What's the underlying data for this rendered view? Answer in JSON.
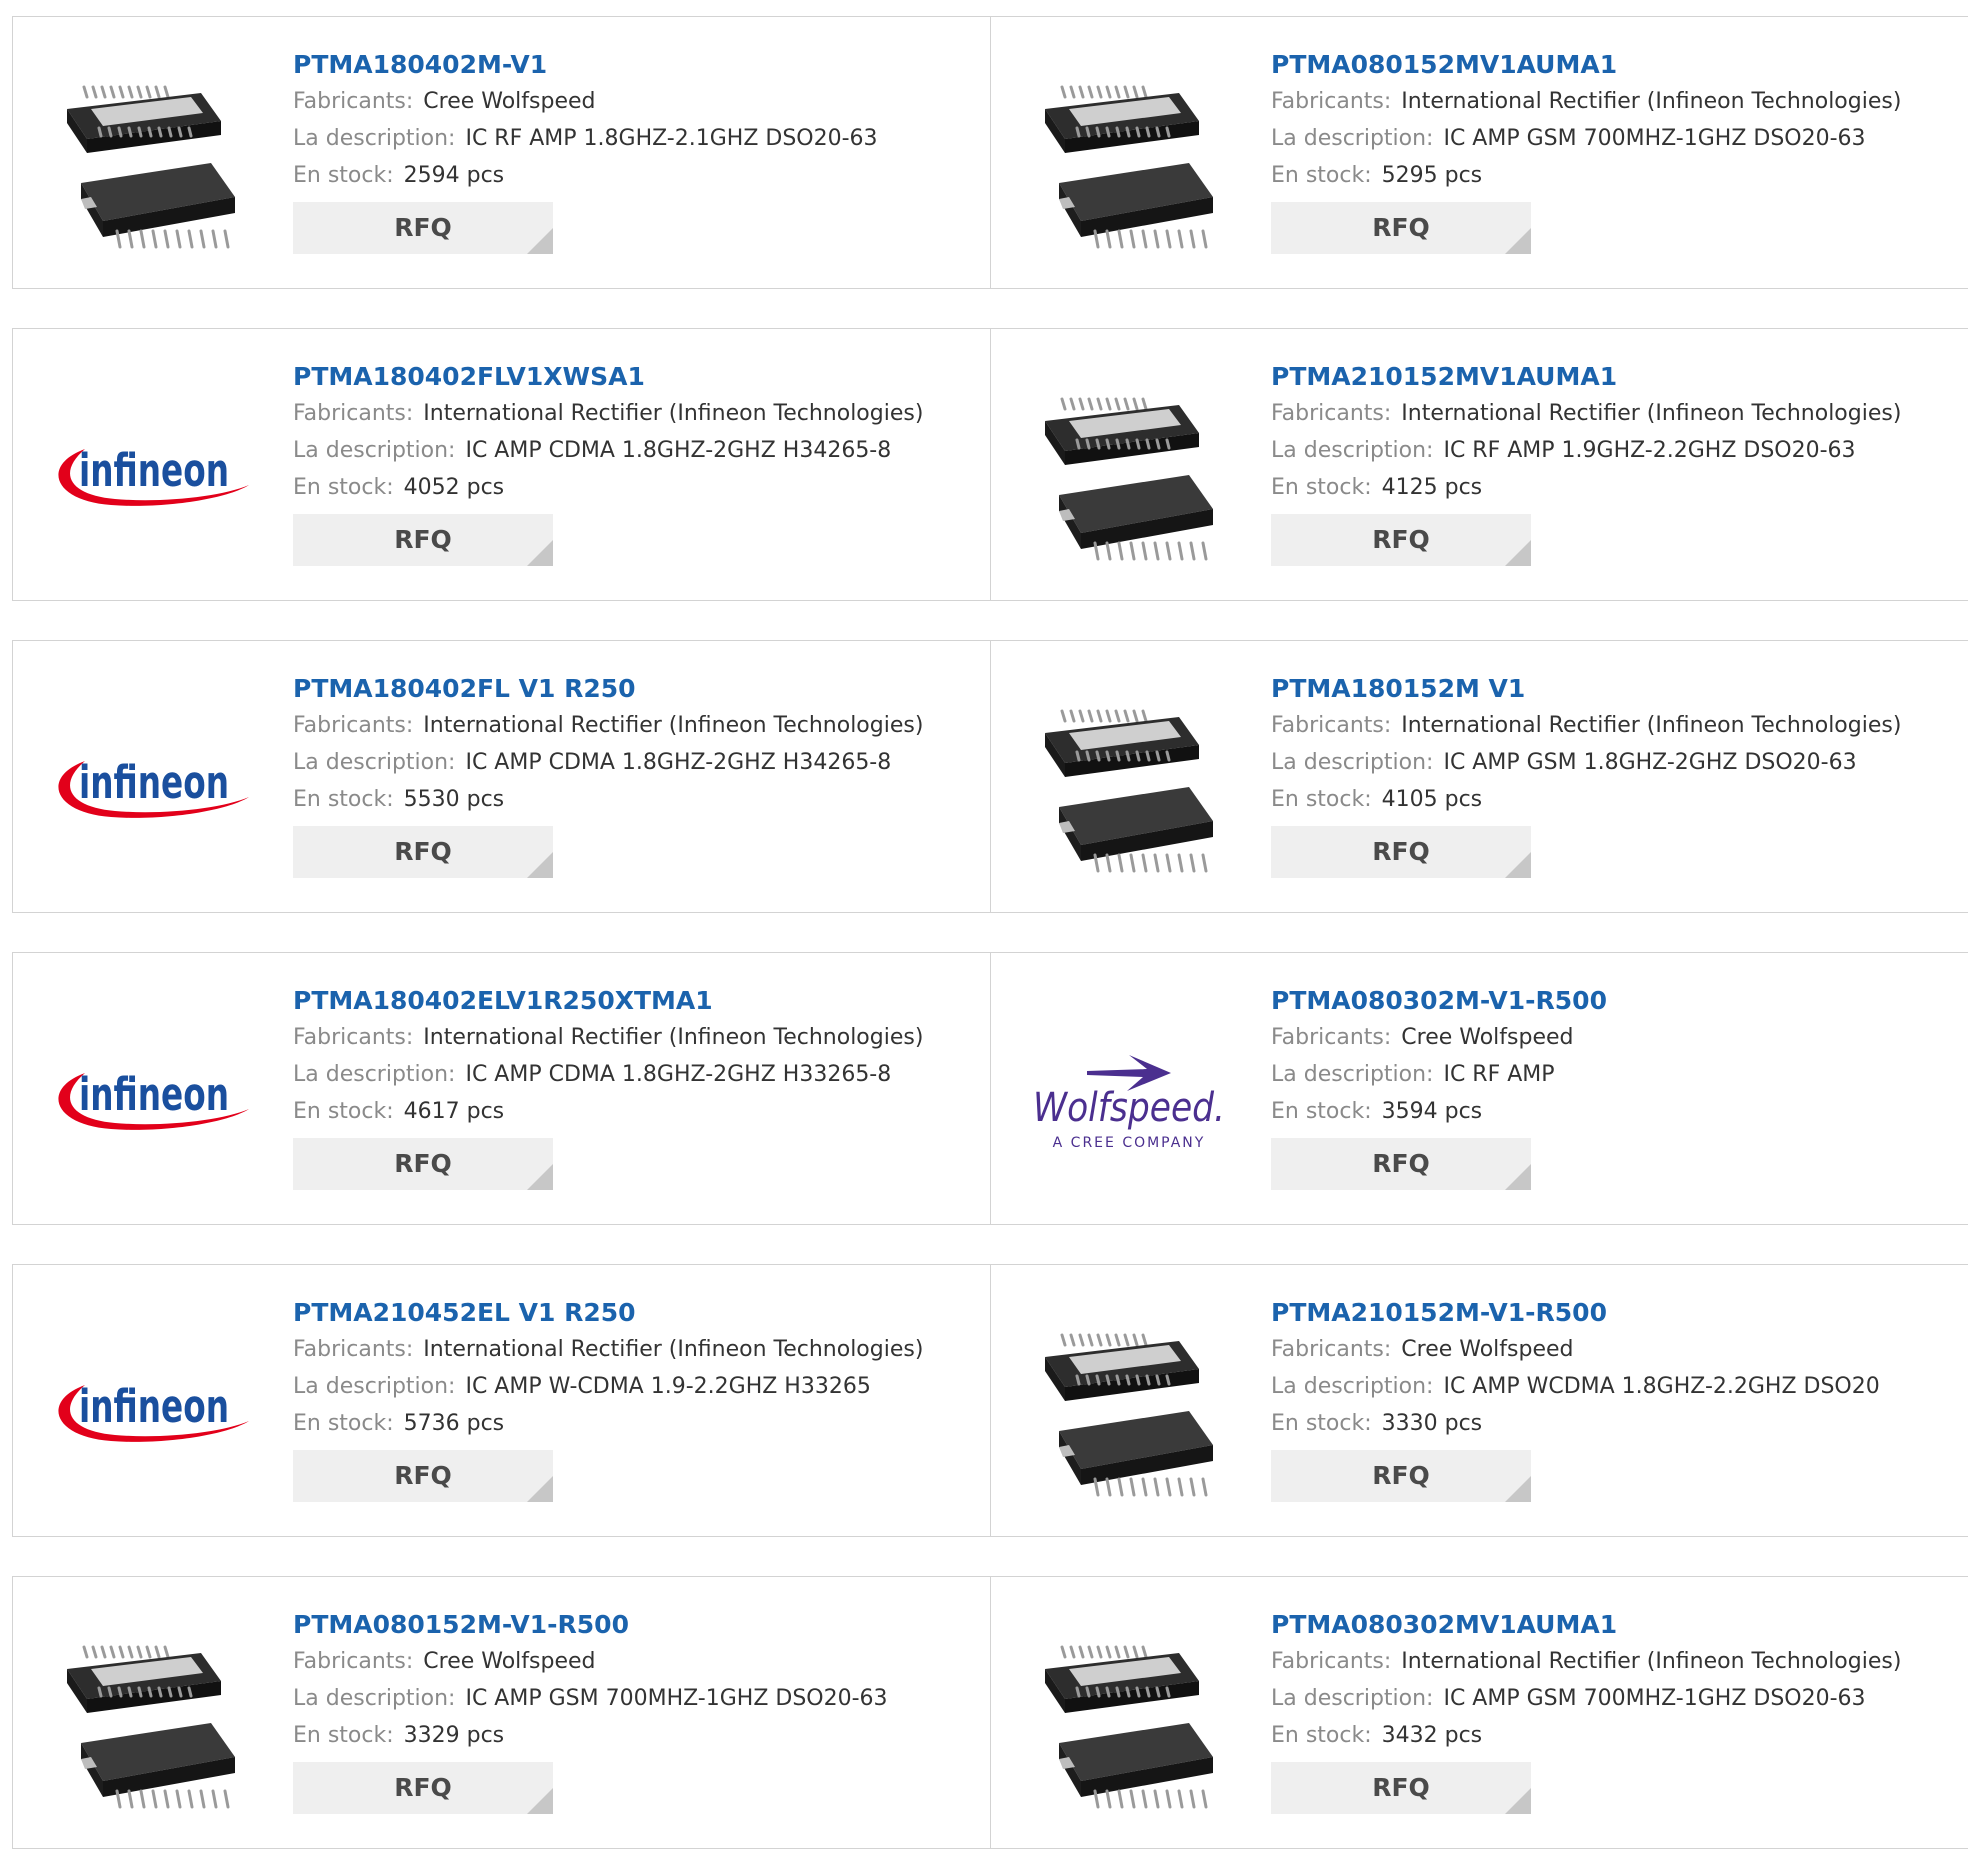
{
  "labels": {
    "manufacturer": "Fabricants:",
    "description": "La description:",
    "stock": "En stock:",
    "rfq": "RFQ"
  },
  "logos": {
    "infineon": {
      "text": "infineon",
      "color": "#1a4f9e",
      "swoosh_color": "#e2001a"
    },
    "wolfspeed": {
      "text": "Wolfspeed.",
      "subtitle": "A CREE COMPANY",
      "color": "#4b2f8f"
    }
  },
  "products": [
    {
      "part": "PTMA180402M-V1",
      "manufacturer": "Cree Wolfspeed",
      "description": "IC RF AMP 1.8GHZ-2.1GHZ DSO20-63",
      "stock": "2594 pcs",
      "image": "ic-package"
    },
    {
      "part": "PTMA080152MV1AUMA1",
      "manufacturer": "International Rectifier (Infineon Technologies)",
      "description": "IC AMP GSM 700MHZ-1GHZ DSO20-63",
      "stock": "5295 pcs",
      "image": "ic-package"
    },
    {
      "part": "PTMA180402FLV1XWSA1",
      "manufacturer": "International Rectifier (Infineon Technologies)",
      "description": "IC AMP CDMA 1.8GHZ-2GHZ H34265-8",
      "stock": "4052 pcs",
      "image": "infineon-logo"
    },
    {
      "part": "PTMA210152MV1AUMA1",
      "manufacturer": "International Rectifier (Infineon Technologies)",
      "description": "IC RF AMP 1.9GHZ-2.2GHZ DSO20-63",
      "stock": "4125 pcs",
      "image": "ic-package"
    },
    {
      "part": "PTMA180402FL V1 R250",
      "manufacturer": "International Rectifier (Infineon Technologies)",
      "description": "IC AMP CDMA 1.8GHZ-2GHZ H34265-8",
      "stock": "5530 pcs",
      "image": "infineon-logo"
    },
    {
      "part": "PTMA180152M V1",
      "manufacturer": "International Rectifier (Infineon Technologies)",
      "description": "IC AMP GSM 1.8GHZ-2GHZ DSO20-63",
      "stock": "4105 pcs",
      "image": "ic-package"
    },
    {
      "part": "PTMA180402ELV1R250XTMA1",
      "manufacturer": "International Rectifier (Infineon Technologies)",
      "description": "IC AMP CDMA 1.8GHZ-2GHZ H33265-8",
      "stock": "4617 pcs",
      "image": "infineon-logo"
    },
    {
      "part": "PTMA080302M-V1-R500",
      "manufacturer": "Cree Wolfspeed",
      "description": "IC RF AMP",
      "stock": "3594 pcs",
      "image": "wolfspeed-logo"
    },
    {
      "part": "PTMA210452EL V1 R250",
      "manufacturer": "International Rectifier (Infineon Technologies)",
      "description": "IC AMP W-CDMA 1.9-2.2GHZ H33265",
      "stock": "5736 pcs",
      "image": "infineon-logo"
    },
    {
      "part": "PTMA210152M-V1-R500",
      "manufacturer": "Cree Wolfspeed",
      "description": "IC AMP WCDMA 1.8GHZ-2.2GHZ DSO20",
      "stock": "3330 pcs",
      "image": "ic-package"
    },
    {
      "part": "PTMA080152M-V1-R500",
      "manufacturer": "Cree Wolfspeed",
      "description": "IC AMP GSM 700MHZ-1GHZ DSO20-63",
      "stock": "3329 pcs",
      "image": "ic-package"
    },
    {
      "part": "PTMA080302MV1AUMA1",
      "manufacturer": "International Rectifier (Infineon Technologies)",
      "description": "IC AMP GSM 700MHZ-1GHZ DSO20-63",
      "stock": "3432 pcs",
      "image": "ic-package"
    }
  ]
}
